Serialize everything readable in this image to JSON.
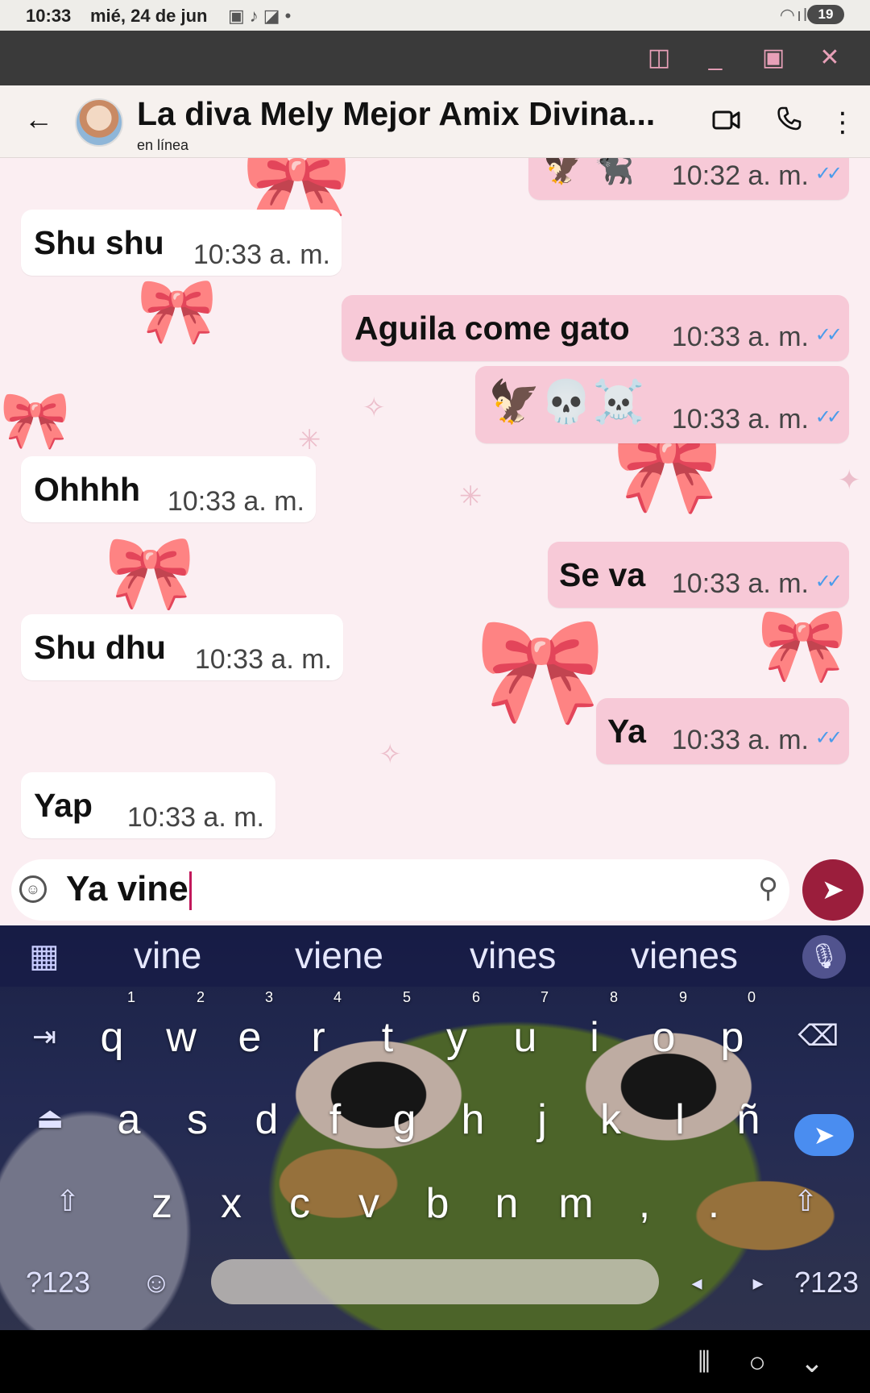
{
  "status_bar": {
    "time": "10:33",
    "date": "mié, 24 de jun",
    "battery": "19"
  },
  "chat_header": {
    "contact_name": "La diva Mely Mejor Amix Divina...",
    "presence": "en línea"
  },
  "messages": [
    {
      "direction": "out",
      "text": "🦅 🐈‍⬛",
      "time": "10:32 a. m.",
      "read": true
    },
    {
      "direction": "in",
      "text": "Shu shu",
      "time": "10:33 a. m."
    },
    {
      "direction": "out",
      "text": "Aguila come gato",
      "time": "10:33 a. m.",
      "read": true
    },
    {
      "direction": "out",
      "text": "🦅💀☠️",
      "time": "10:33 a. m.",
      "read": true
    },
    {
      "direction": "in",
      "text": "Ohhhh",
      "time": "10:33 a. m."
    },
    {
      "direction": "out",
      "text": "Se va",
      "time": "10:33 a. m.",
      "read": true
    },
    {
      "direction": "in",
      "text": "Shu dhu",
      "time": "10:33 a. m."
    },
    {
      "direction": "out",
      "text": "Ya",
      "time": "10:33 a. m.",
      "read": true
    },
    {
      "direction": "in",
      "text": "Yap",
      "time": "10:33 a. m."
    }
  ],
  "composer": {
    "value": "Ya vine"
  },
  "keyboard": {
    "suggestions": [
      "vine",
      "viene",
      "vines",
      "vienes"
    ],
    "row1": [
      "q",
      "w",
      "e",
      "r",
      "t",
      "y",
      "u",
      "i",
      "o",
      "p"
    ],
    "row1_hints": [
      "1",
      "2",
      "3",
      "4",
      "5",
      "6",
      "7",
      "8",
      "9",
      "0"
    ],
    "row2": [
      "a",
      "s",
      "d",
      "f",
      "g",
      "h",
      "j",
      "k",
      "l",
      "ñ"
    ],
    "row3": [
      "z",
      "x",
      "c",
      "v",
      "b",
      "n",
      "m",
      ",",
      "."
    ],
    "symbols_label": "?123"
  },
  "colors": {
    "incoming_bubble": "#ffffff",
    "outgoing_bubble": "#f7c9d7",
    "send_button": "#9b1e3c",
    "read_ticks": "#4a9bea"
  }
}
